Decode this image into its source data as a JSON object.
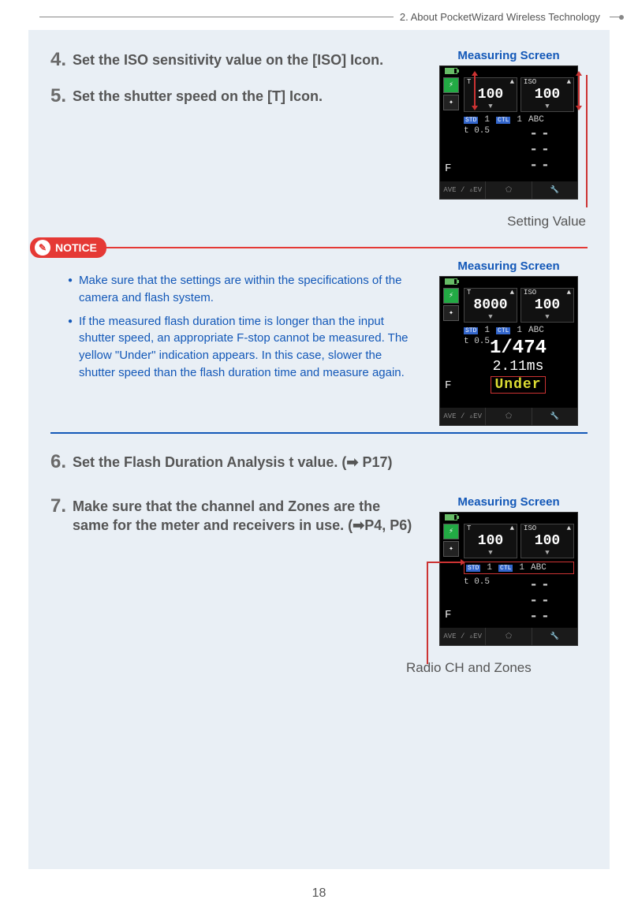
{
  "header": {
    "section": "2.  About PocketWizard Wireless Technology"
  },
  "steps": {
    "s4": {
      "num": "4.",
      "text": "Set the ISO sensitivity value on the [ISO] Icon."
    },
    "s5": {
      "num": "5.",
      "text": "Set the shutter speed on the [T] Icon."
    },
    "s6": {
      "num": "6.",
      "text": "Set the Flash Duration Analysis t value. (➡ P17)"
    },
    "s7": {
      "num": "7.",
      "text": "Make sure that the channel and Zones are the same for the meter and receivers in use. (➡P4, P6)"
    }
  },
  "screen1": {
    "label": "Measuring Screen",
    "t_hdr": "T",
    "iso_hdr": "ISO",
    "t_val": "100",
    "iso_val": "100",
    "arr_up": "▲",
    "arr_dn": "▼",
    "std": "STD",
    "stdn": "1",
    "ctl": "CTL",
    "ctln": "1",
    "abc": "ABC",
    "sub": "t 0.5",
    "dash": "--",
    "f": "F",
    "bottom_ave": "AVE / ▵EV",
    "bottom_mid": "⬠",
    "bottom_r": "🔧",
    "callout": "Setting Value"
  },
  "notice": {
    "tag": "NOTICE",
    "items": [
      "Make sure that the settings are within the specifications of the camera and flash system.",
      "If the measured flash duration time is longer than the input shutter speed, an appropriate F-stop cannot be measured. The yellow \"Under\" indication appears. In this case, slower the shutter speed than the flash duration time and measure again."
    ]
  },
  "screen2": {
    "label": "Measuring Screen",
    "t_val": "8000",
    "iso_val": "100",
    "r1": "1/474",
    "r2": "2.11ms",
    "under": "Under",
    "f": "F"
  },
  "screen3": {
    "label": "Measuring Screen",
    "t_val": "100",
    "iso_val": "100",
    "callout": "Radio CH and Zones"
  },
  "page": "18"
}
